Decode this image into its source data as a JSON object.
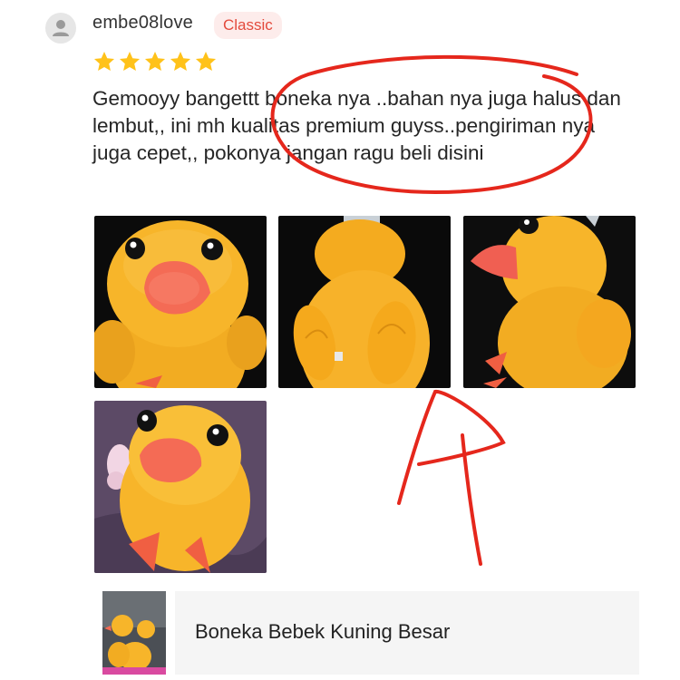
{
  "review": {
    "username": "embe08love",
    "badge": "Classic",
    "rating": 5,
    "rating_max": 5,
    "text": "Gemooyy bangettt boneka nya ..bahan nya juga halus dan lembut,, ini mh kualitas premium guyss..pengiriman nya juga cepet,, pokonya jangan ragu beli disini",
    "photo_count": 4
  },
  "product": {
    "name": "Boneka Bebek Kuning Besar"
  },
  "colors": {
    "badge_text": "#e34a3c",
    "badge_bg": "#fdeceb",
    "star": "#ffc21a",
    "markup_red": "#e5271c",
    "duck_yellow": "#f7b52a",
    "beak": "#f46b55"
  },
  "icons": {
    "avatar": "user-icon",
    "rating": "star-icon"
  }
}
